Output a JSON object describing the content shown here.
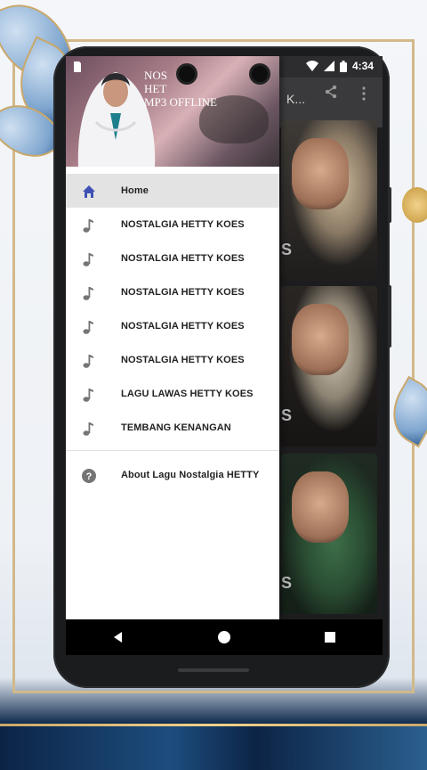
{
  "status_bar": {
    "time": "4:34"
  },
  "app_bar": {
    "title": "K...",
    "share_icon": "share-icon",
    "more_icon": "more-vert-icon"
  },
  "drawer": {
    "header_title": "NOS\nHET\nMP3 OFFLINE",
    "items": [
      {
        "label": "Home",
        "icon": "home-icon",
        "active": true
      },
      {
        "label": "NOSTALGIA HETTY KOES",
        "icon": "music-note-icon"
      },
      {
        "label": "NOSTALGIA HETTY KOES",
        "icon": "music-note-icon"
      },
      {
        "label": "NOSTALGIA HETTY KOES",
        "icon": "music-note-icon"
      },
      {
        "label": "NOSTALGIA HETTY KOES",
        "icon": "music-note-icon"
      },
      {
        "label": "NOSTALGIA HETTY KOES",
        "icon": "music-note-icon"
      },
      {
        "label": "LAGU LAWAS HETTY KOES",
        "icon": "music-note-icon"
      },
      {
        "label": "TEMBANG KENANGAN",
        "icon": "music-note-icon"
      }
    ],
    "about": {
      "label": "About Lagu Nostalgia HETTY",
      "icon": "help-circle-icon"
    }
  },
  "cards": [
    {
      "label": "S"
    },
    {
      "label": "S"
    },
    {
      "label": "S"
    }
  ],
  "colors": {
    "accent": "#3f51b5",
    "drawer_bg": "#ffffff",
    "active_bg": "#e3e3e3"
  }
}
